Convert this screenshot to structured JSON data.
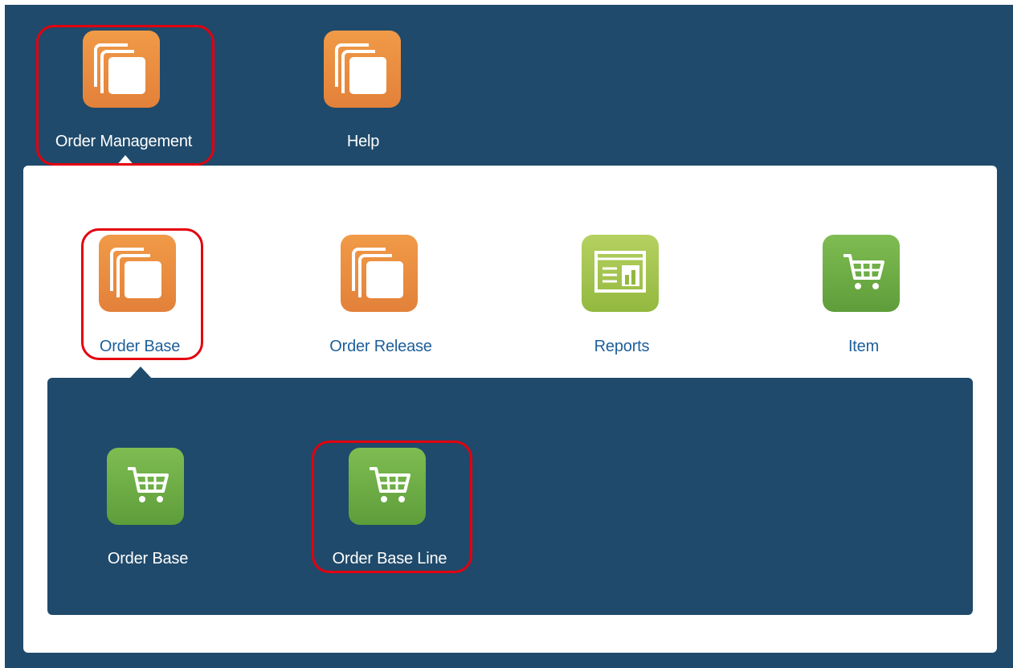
{
  "top_menu": {
    "items": [
      {
        "label": "Order Management",
        "icon": "stacked-pages-icon"
      },
      {
        "label": "Help",
        "icon": "stacked-pages-icon"
      }
    ]
  },
  "module_menu": {
    "items": [
      {
        "label": "Order Base",
        "icon": "stacked-pages-icon"
      },
      {
        "label": "Order Release",
        "icon": "stacked-pages-icon"
      },
      {
        "label": "Reports",
        "icon": "report-icon"
      },
      {
        "label": "Item",
        "icon": "shopping-cart-icon"
      }
    ]
  },
  "sub_menu": {
    "items": [
      {
        "label": "Order Base",
        "icon": "shopping-cart-icon"
      },
      {
        "label": "Order Base Line",
        "icon": "shopping-cart-icon"
      }
    ]
  },
  "colors": {
    "background_navy": "#1f4a6b",
    "tile_orange": "#e98a3f",
    "tile_green": "#6aa844",
    "highlight_red": "#e3000f",
    "link_blue": "#1e5f9a"
  }
}
